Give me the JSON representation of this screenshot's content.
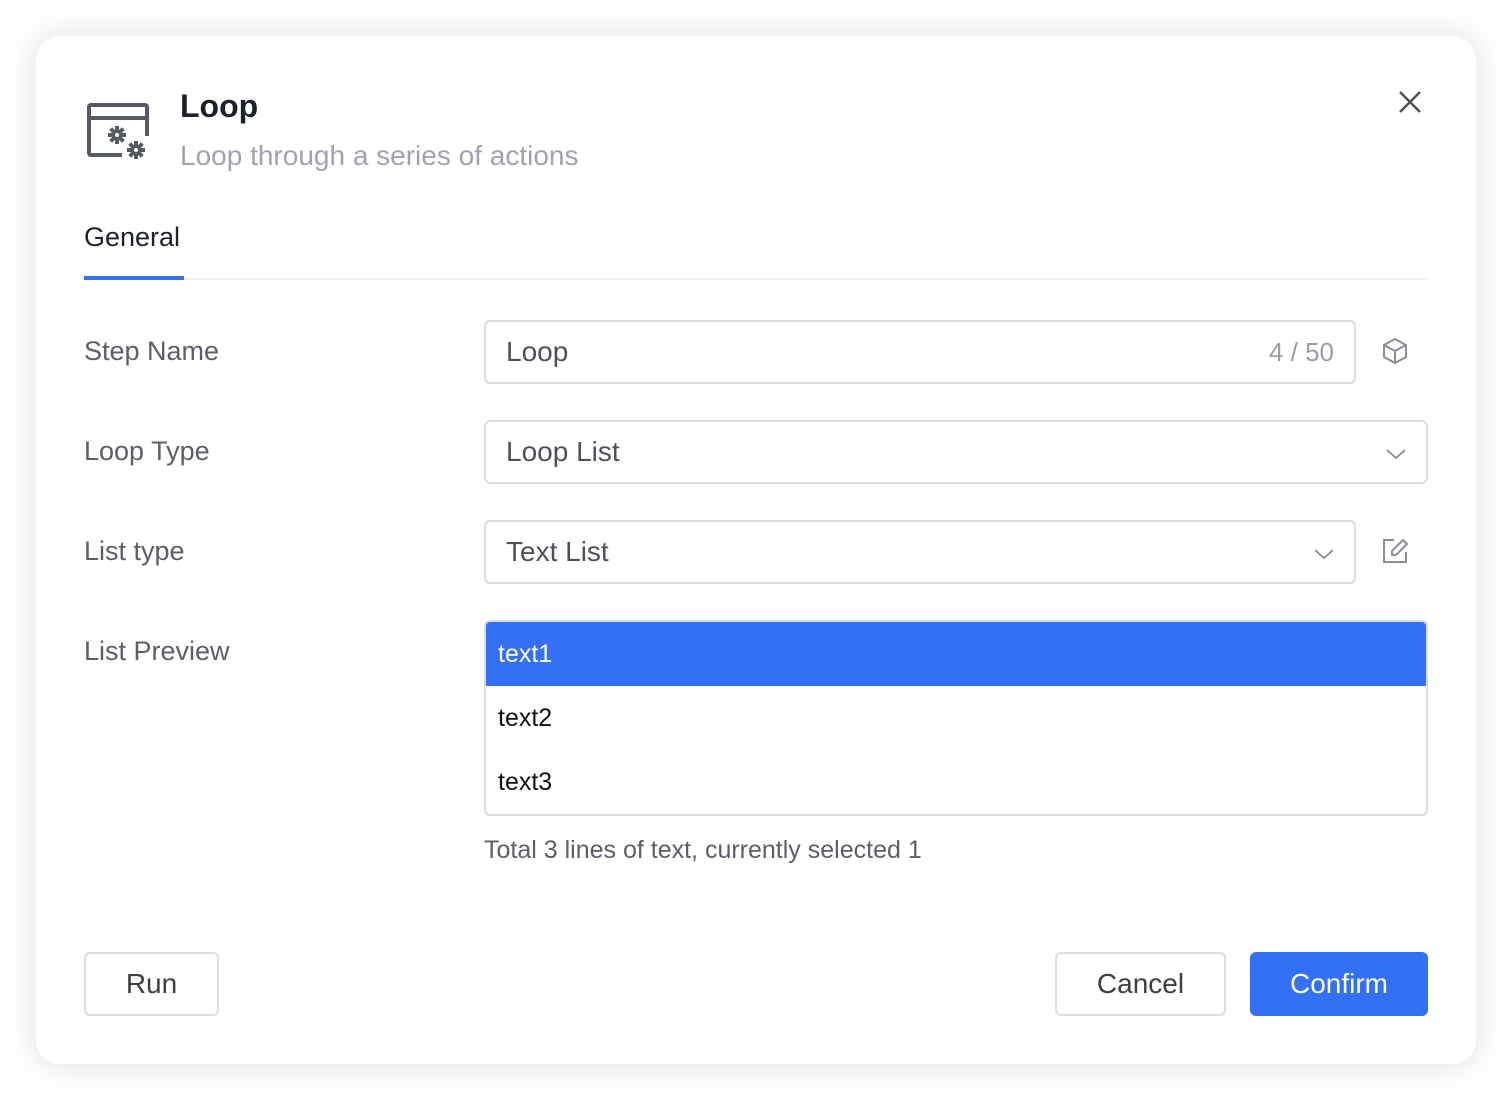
{
  "dialog": {
    "title": "Loop",
    "subtitle": "Loop through a series of actions",
    "header_icon": "window-gears-icon",
    "close_icon": "close-icon"
  },
  "tabs": [
    {
      "label": "General",
      "active": true
    }
  ],
  "form": {
    "step_name": {
      "label": "Step Name",
      "value": "Loop",
      "counter": "4 / 50",
      "side_icon": "cube-icon"
    },
    "loop_type": {
      "label": "Loop Type",
      "value": "Loop List"
    },
    "list_type": {
      "label": "List type",
      "value": "Text List",
      "side_icon": "edit-icon"
    },
    "list_preview": {
      "label": "List Preview",
      "items": [
        "text1",
        "text2",
        "text3"
      ],
      "selected_index": 0,
      "hint": "Total 3 lines of text, currently selected 1"
    }
  },
  "footer": {
    "run_label": "Run",
    "cancel_label": "Cancel",
    "confirm_label": "Confirm"
  },
  "colors": {
    "accent": "#3370f5",
    "border": "#dcdde2",
    "title": "#1d2129",
    "subtitle": "#a0a3ab"
  }
}
